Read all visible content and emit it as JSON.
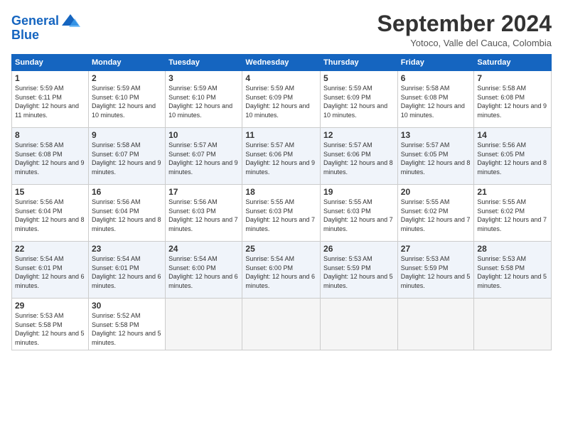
{
  "logo": {
    "text_general": "General",
    "text_blue": "Blue"
  },
  "header": {
    "title": "September 2024",
    "location": "Yotoco, Valle del Cauca, Colombia"
  },
  "weekdays": [
    "Sunday",
    "Monday",
    "Tuesday",
    "Wednesday",
    "Thursday",
    "Friday",
    "Saturday"
  ],
  "weeks": [
    [
      {
        "day": "1",
        "sunrise": "5:59 AM",
        "sunset": "6:11 PM",
        "daylight": "12 hours and 11 minutes."
      },
      {
        "day": "2",
        "sunrise": "5:59 AM",
        "sunset": "6:10 PM",
        "daylight": "12 hours and 10 minutes."
      },
      {
        "day": "3",
        "sunrise": "5:59 AM",
        "sunset": "6:10 PM",
        "daylight": "12 hours and 10 minutes."
      },
      {
        "day": "4",
        "sunrise": "5:59 AM",
        "sunset": "6:09 PM",
        "daylight": "12 hours and 10 minutes."
      },
      {
        "day": "5",
        "sunrise": "5:59 AM",
        "sunset": "6:09 PM",
        "daylight": "12 hours and 10 minutes."
      },
      {
        "day": "6",
        "sunrise": "5:58 AM",
        "sunset": "6:08 PM",
        "daylight": "12 hours and 10 minutes."
      },
      {
        "day": "7",
        "sunrise": "5:58 AM",
        "sunset": "6:08 PM",
        "daylight": "12 hours and 9 minutes."
      }
    ],
    [
      {
        "day": "8",
        "sunrise": "5:58 AM",
        "sunset": "6:08 PM",
        "daylight": "12 hours and 9 minutes."
      },
      {
        "day": "9",
        "sunrise": "5:58 AM",
        "sunset": "6:07 PM",
        "daylight": "12 hours and 9 minutes."
      },
      {
        "day": "10",
        "sunrise": "5:57 AM",
        "sunset": "6:07 PM",
        "daylight": "12 hours and 9 minutes."
      },
      {
        "day": "11",
        "sunrise": "5:57 AM",
        "sunset": "6:06 PM",
        "daylight": "12 hours and 9 minutes."
      },
      {
        "day": "12",
        "sunrise": "5:57 AM",
        "sunset": "6:06 PM",
        "daylight": "12 hours and 8 minutes."
      },
      {
        "day": "13",
        "sunrise": "5:57 AM",
        "sunset": "6:05 PM",
        "daylight": "12 hours and 8 minutes."
      },
      {
        "day": "14",
        "sunrise": "5:56 AM",
        "sunset": "6:05 PM",
        "daylight": "12 hours and 8 minutes."
      }
    ],
    [
      {
        "day": "15",
        "sunrise": "5:56 AM",
        "sunset": "6:04 PM",
        "daylight": "12 hours and 8 minutes."
      },
      {
        "day": "16",
        "sunrise": "5:56 AM",
        "sunset": "6:04 PM",
        "daylight": "12 hours and 8 minutes."
      },
      {
        "day": "17",
        "sunrise": "5:56 AM",
        "sunset": "6:03 PM",
        "daylight": "12 hours and 7 minutes."
      },
      {
        "day": "18",
        "sunrise": "5:55 AM",
        "sunset": "6:03 PM",
        "daylight": "12 hours and 7 minutes."
      },
      {
        "day": "19",
        "sunrise": "5:55 AM",
        "sunset": "6:03 PM",
        "daylight": "12 hours and 7 minutes."
      },
      {
        "day": "20",
        "sunrise": "5:55 AM",
        "sunset": "6:02 PM",
        "daylight": "12 hours and 7 minutes."
      },
      {
        "day": "21",
        "sunrise": "5:55 AM",
        "sunset": "6:02 PM",
        "daylight": "12 hours and 7 minutes."
      }
    ],
    [
      {
        "day": "22",
        "sunrise": "5:54 AM",
        "sunset": "6:01 PM",
        "daylight": "12 hours and 6 minutes."
      },
      {
        "day": "23",
        "sunrise": "5:54 AM",
        "sunset": "6:01 PM",
        "daylight": "12 hours and 6 minutes."
      },
      {
        "day": "24",
        "sunrise": "5:54 AM",
        "sunset": "6:00 PM",
        "daylight": "12 hours and 6 minutes."
      },
      {
        "day": "25",
        "sunrise": "5:54 AM",
        "sunset": "6:00 PM",
        "daylight": "12 hours and 6 minutes."
      },
      {
        "day": "26",
        "sunrise": "5:53 AM",
        "sunset": "5:59 PM",
        "daylight": "12 hours and 5 minutes."
      },
      {
        "day": "27",
        "sunrise": "5:53 AM",
        "sunset": "5:59 PM",
        "daylight": "12 hours and 5 minutes."
      },
      {
        "day": "28",
        "sunrise": "5:53 AM",
        "sunset": "5:58 PM",
        "daylight": "12 hours and 5 minutes."
      }
    ],
    [
      {
        "day": "29",
        "sunrise": "5:53 AM",
        "sunset": "5:58 PM",
        "daylight": "12 hours and 5 minutes."
      },
      {
        "day": "30",
        "sunrise": "5:52 AM",
        "sunset": "5:58 PM",
        "daylight": "12 hours and 5 minutes."
      },
      null,
      null,
      null,
      null,
      null
    ]
  ]
}
